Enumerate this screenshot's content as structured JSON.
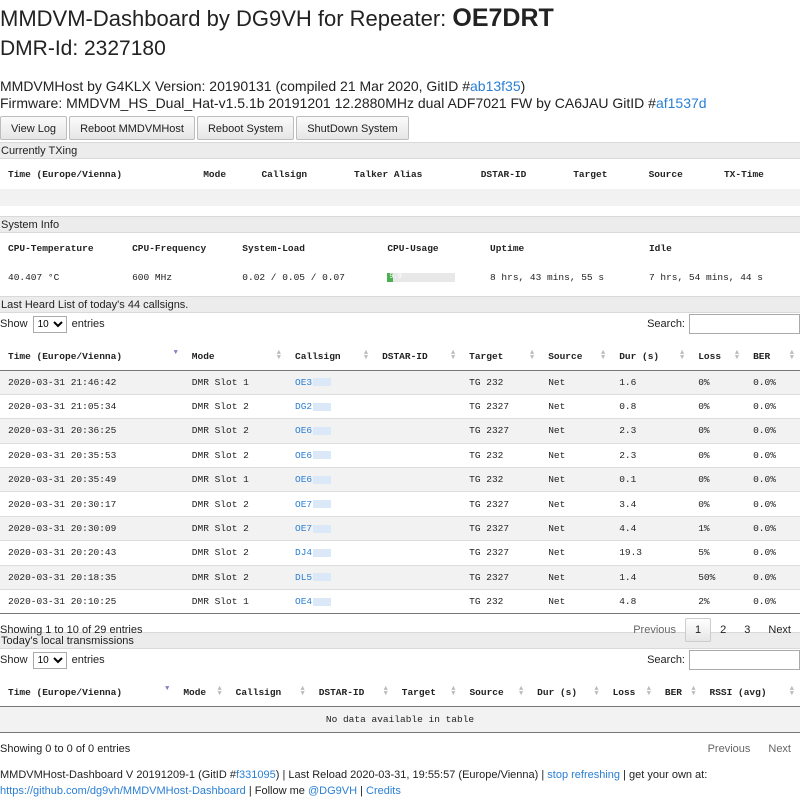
{
  "header": {
    "title_prefix": "MMDVM-Dashboard by DG9VH for Repeater:",
    "repeater": "OE7DRT",
    "dmr_id": "DMR-Id: 2327180"
  },
  "info": {
    "host_text": "MMDVMHost by G4KLX Version: 20190131 (compiled 21 Mar 2020, GitID #",
    "host_gitid": "ab13f35",
    "host_close": ")",
    "fw_text": "Firmware: MMDVM_HS_Dual_Hat-v1.5.1b 20191201 12.2880MHz dual ADF7021 FW by CA6JAU GitID #",
    "fw_gitid": "af1537d"
  },
  "toolbar": {
    "view_log": "View Log",
    "reboot_mmdvm": "Reboot MMDVMHost",
    "reboot_system": "Reboot System",
    "shutdown": "ShutDown System"
  },
  "currently_txing": {
    "title": "Currently TXing",
    "columns": [
      "Time (Europe/Vienna)",
      "Mode",
      "Callsign",
      "Talker Alias",
      "DSTAR-ID",
      "Target",
      "Source",
      "TX-Time"
    ]
  },
  "system_info": {
    "title": "System Info",
    "columns": [
      "CPU-Temperature",
      "CPU-Frequency",
      "System-Load",
      "CPU-Usage",
      "Uptime",
      "Idle"
    ],
    "temperature": "40.407 °C",
    "frequency": "600 MHz",
    "load": "0.02 / 0.05 / 0.07",
    "cpu_usage_fraction": 0.09,
    "cpu_usage_label": "9.9",
    "uptime": "8 hrs, 43 mins, 55 s",
    "idle": "7 hrs, 54 mins, 44 s"
  },
  "last_heard": {
    "title": "Last Heard List of today's 44 callsigns.",
    "show": "Show",
    "entries_value": "10",
    "entries": "entries",
    "search_label": "Search:",
    "columns": [
      "Time (Europe/Vienna)",
      "Mode",
      "Callsign",
      "DSTAR-ID",
      "Target",
      "Source",
      "Dur (s)",
      "Loss",
      "BER"
    ],
    "rows": [
      {
        "time": "2020-03-31 21:46:42",
        "mode": "DMR Slot 1",
        "callsign": "OE3",
        "dstar": "",
        "target": "TG 232",
        "source": "Net",
        "dur": "1.6",
        "loss": "0%",
        "ber": "0.0%"
      },
      {
        "time": "2020-03-31 21:05:34",
        "mode": "DMR Slot 2",
        "callsign": "DG2",
        "dstar": "",
        "target": "TG 2327",
        "source": "Net",
        "dur": "0.8",
        "loss": "0%",
        "ber": "0.0%"
      },
      {
        "time": "2020-03-31 20:36:25",
        "mode": "DMR Slot 2",
        "callsign": "OE6",
        "dstar": "",
        "target": "TG 2327",
        "source": "Net",
        "dur": "2.3",
        "loss": "0%",
        "ber": "0.0%"
      },
      {
        "time": "2020-03-31 20:35:53",
        "mode": "DMR Slot 2",
        "callsign": "OE6",
        "dstar": "",
        "target": "TG 232",
        "source": "Net",
        "dur": "2.3",
        "loss": "0%",
        "ber": "0.0%"
      },
      {
        "time": "2020-03-31 20:35:49",
        "mode": "DMR Slot 1",
        "callsign": "OE6",
        "dstar": "",
        "target": "TG 232",
        "source": "Net",
        "dur": "0.1",
        "loss": "0%",
        "ber": "0.0%"
      },
      {
        "time": "2020-03-31 20:30:17",
        "mode": "DMR Slot 2",
        "callsign": "OE7",
        "dstar": "",
        "target": "TG 2327",
        "source": "Net",
        "dur": "3.4",
        "loss": "0%",
        "ber": "0.0%"
      },
      {
        "time": "2020-03-31 20:30:09",
        "mode": "DMR Slot 2",
        "callsign": "OE7",
        "dstar": "",
        "target": "TG 2327",
        "source": "Net",
        "dur": "4.4",
        "loss": "1%",
        "ber": "0.0%"
      },
      {
        "time": "2020-03-31 20:20:43",
        "mode": "DMR Slot 2",
        "callsign": "DJ4",
        "dstar": "",
        "target": "TG 2327",
        "source": "Net",
        "dur": "19.3",
        "loss": "5%",
        "ber": "0.0%"
      },
      {
        "time": "2020-03-31 20:18:35",
        "mode": "DMR Slot 2",
        "callsign": "DL5",
        "dstar": "",
        "target": "TG 2327",
        "source": "Net",
        "dur": "1.4",
        "loss": "50%",
        "ber": "0.0%"
      },
      {
        "time": "2020-03-31 20:10:25",
        "mode": "DMR Slot 1",
        "callsign": "OE4",
        "dstar": "",
        "target": "TG 232",
        "source": "Net",
        "dur": "4.8",
        "loss": "2%",
        "ber": "0.0%"
      }
    ],
    "info": "Showing 1 to 10 of 29 entries",
    "previous": "Previous",
    "pages": [
      "1",
      "2",
      "3"
    ],
    "next": "Next"
  },
  "local_tx": {
    "title": "Today's local transmissions",
    "show": "Show",
    "entries_value": "10",
    "entries": "entries",
    "search_label": "Search:",
    "columns": [
      "Time (Europe/Vienna)",
      "Mode",
      "Callsign",
      "DSTAR-ID",
      "Target",
      "Source",
      "Dur (s)",
      "Loss",
      "BER",
      "RSSI (avg)"
    ],
    "empty": "No data available in table",
    "info": "Showing 0 to 0 of 0 entries",
    "previous": "Previous",
    "next": "Next"
  },
  "footer": {
    "text1": "MMDVMHost-Dashboard V 20191209-1 (GitID #",
    "gitid": "f331095",
    "text2": ") | Last Reload 2020-03-31, 19:55:57 (Europe/Vienna) |",
    "stop": "stop refreshing",
    "text3": "| get your own at:",
    "github": "https://github.com/dg9vh/MMDVMHost-Dashboard",
    "text4": "| Follow me",
    "twitter": "@DG9VH",
    "sep": "|",
    "credits": "Credits"
  },
  "colors": {
    "link": "#2a7fd4",
    "section_bg": "#ececec",
    "cpu_bar": "#4caf50"
  }
}
